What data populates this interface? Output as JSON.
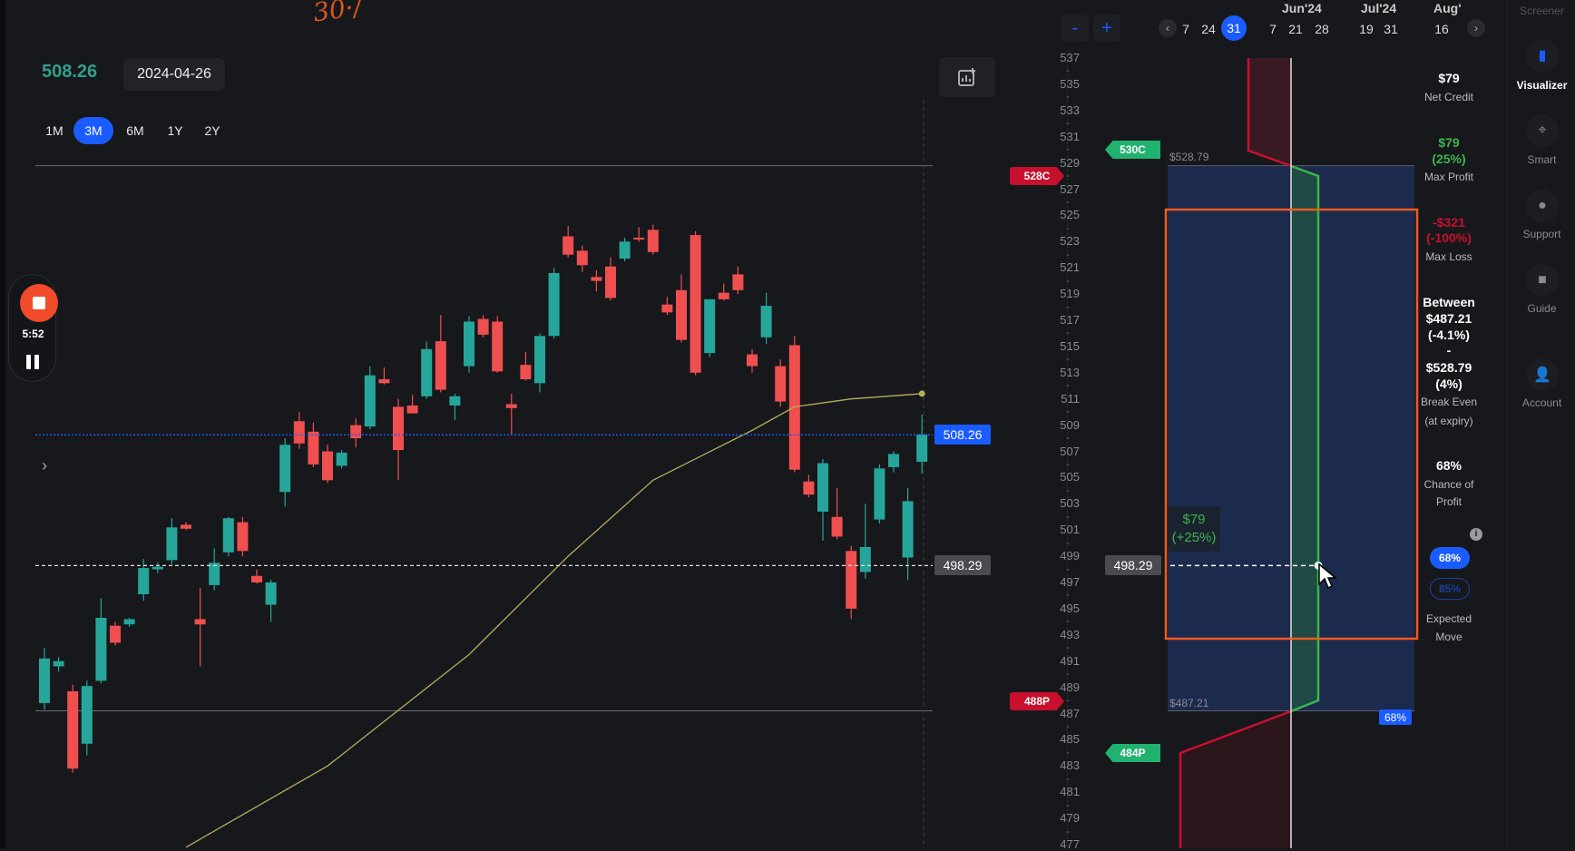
{
  "header": {
    "price": "508.26",
    "date": "2024-04-26",
    "annotation": "30·/"
  },
  "timeframes": [
    {
      "label": "1M"
    },
    {
      "label": "3M",
      "active": true
    },
    {
      "label": "6M"
    },
    {
      "label": "1Y"
    },
    {
      "label": "2Y"
    }
  ],
  "recorder": {
    "time": "5:52"
  },
  "price_tags": {
    "current": "508.26",
    "cursor": "498.29",
    "cursor_right": "498.29"
  },
  "strikes": {
    "short_call": "528C",
    "long_call": "530C",
    "short_put": "488P",
    "long_put": "484P"
  },
  "breakeven_labels": {
    "upper": "$528.79",
    "lower": "$487.21",
    "prob": "68%"
  },
  "tooltip": {
    "value": "$79",
    "pct": "(+25%)"
  },
  "zoom": {
    "minus": "-",
    "plus": "+"
  },
  "dates": {
    "months": [
      "Jun'24",
      "Jul'24",
      "Aug'"
    ],
    "days": [
      "7",
      "24",
      "31",
      "7",
      "21",
      "28",
      "19",
      "31",
      "16"
    ],
    "selected": "31"
  },
  "stats": {
    "net_credit": {
      "value": "$79",
      "label": "Net Credit"
    },
    "max_profit": {
      "value": "$79",
      "pct": "(25%)",
      "label": "Max Profit"
    },
    "max_loss": {
      "value": "-$321",
      "pct": "(-100%)",
      "label": "Max Loss"
    },
    "break_even": {
      "prefix": "Between",
      "low": "$487.21",
      "low_pct": "(-4.1%)",
      "sep": "-",
      "high": "$528.79",
      "high_pct": "(4%)",
      "label": "Break Even",
      "sub": "(at expiry)"
    },
    "chance": {
      "value": "68%",
      "label1": "Chance of",
      "label2": "Profit"
    },
    "expected_move": {
      "opt1": "68%",
      "opt2": "85%",
      "selected": "68%",
      "label1": "Expected",
      "label2": "Move"
    }
  },
  "sidebar": {
    "items": [
      {
        "label": "Screener"
      },
      {
        "label": "Visualizer",
        "active": true
      },
      {
        "label": "Smart"
      },
      {
        "label": "Support"
      },
      {
        "label": "Guide"
      },
      {
        "label": "Account"
      }
    ]
  },
  "colors": {
    "up": "#26a69a",
    "down": "#ef4f4f",
    "accent": "#1a5cff",
    "ma": "#b5ad5c",
    "profit_zone": "#1c2a4e",
    "expected_move_box": "#f05a1e"
  },
  "chart_data": {
    "type": "candlestick",
    "ylim": [
      477,
      537
    ],
    "axis_ticks": [
      537,
      535,
      533,
      531,
      529,
      527,
      525,
      523,
      521,
      519,
      517,
      515,
      513,
      511,
      509,
      507,
      505,
      503,
      501,
      499,
      497,
      495,
      493,
      491,
      489,
      487,
      485,
      483,
      481,
      479,
      477
    ],
    "reference_lines": {
      "current": 508.26,
      "cursor": 498.29,
      "upper_breakeven": 528.79,
      "lower_breakeven": 487.21
    },
    "ohlc": [
      [
        487.8,
        492,
        487.3,
        491.2
      ],
      [
        490.6,
        491.3,
        490.2,
        491
      ],
      [
        488.7,
        489.2,
        482.5,
        482.8
      ],
      [
        484.7,
        489.5,
        483.8,
        489.1
      ],
      [
        489.5,
        495.8,
        489.3,
        494.3
      ],
      [
        493.7,
        494,
        492.2,
        492.4
      ],
      [
        493.8,
        494.3,
        493.6,
        494.2
      ],
      [
        496.1,
        498.8,
        495.6,
        498.1
      ],
      [
        498,
        498.5,
        497.7,
        498.2
      ],
      [
        498.7,
        501.9,
        498.4,
        501.2
      ],
      [
        501.4,
        501.6,
        501,
        501.1
      ],
      [
        494.2,
        496.6,
        490.6,
        493.8
      ],
      [
        496.8,
        499.6,
        496.4,
        498.5
      ],
      [
        499.3,
        502,
        499,
        501.9
      ],
      [
        501.6,
        502,
        499,
        499.4
      ],
      [
        497.5,
        498,
        496.9,
        497
      ],
      [
        495.3,
        497.2,
        494,
        497
      ],
      [
        503.9,
        508,
        502.8,
        507.5
      ],
      [
        509.3,
        510,
        507.2,
        507.6
      ],
      [
        508.5,
        509.2,
        505.8,
        506
      ],
      [
        507,
        507.5,
        504.6,
        504.8
      ],
      [
        505.9,
        507.1,
        505.7,
        506.9
      ],
      [
        509,
        509.5,
        507.3,
        508
      ],
      [
        508.9,
        513.5,
        508.7,
        512.8
      ],
      [
        512.5,
        513.4,
        512.1,
        512.2
      ],
      [
        510.4,
        511,
        504.8,
        507.1
      ],
      [
        510.5,
        511.3,
        509.9,
        509.9
      ],
      [
        511.2,
        515.4,
        511,
        514.8
      ],
      [
        515.4,
        517.4,
        511.5,
        511.7
      ],
      [
        510.5,
        511.4,
        509.4,
        511.2
      ],
      [
        513.5,
        517.3,
        513,
        516.9
      ],
      [
        517.1,
        517.4,
        515.7,
        515.9
      ],
      [
        516.9,
        517.3,
        513,
        513.1
      ],
      [
        510.6,
        511.4,
        508.3,
        510.3
      ],
      [
        513.6,
        514.6,
        512.4,
        512.5
      ],
      [
        512.2,
        516,
        511.5,
        515.8
      ],
      [
        515.8,
        521,
        515.6,
        520.6
      ],
      [
        523.4,
        524.2,
        521.8,
        522
      ],
      [
        522.3,
        522.7,
        520.7,
        521.2
      ],
      [
        520.3,
        520.8,
        519.2,
        520
      ],
      [
        521.1,
        521.8,
        518.5,
        518.7
      ],
      [
        521.7,
        523.3,
        521.5,
        523
      ],
      [
        523.3,
        524.1,
        523,
        523.2
      ],
      [
        523.9,
        524.3,
        522,
        522.2
      ],
      [
        518.2,
        518.8,
        517.4,
        517.6
      ],
      [
        519.3,
        520.5,
        515.3,
        515.5
      ],
      [
        523.5,
        523.8,
        512.8,
        513
      ],
      [
        514.5,
        518.6,
        514.2,
        518.6
      ],
      [
        519.1,
        519.8,
        518.5,
        518.6
      ],
      [
        520.5,
        521.1,
        519,
        519.3
      ],
      [
        514.4,
        514.8,
        513,
        513.5
      ],
      [
        515.7,
        519.1,
        515.2,
        518.1
      ],
      [
        513.5,
        514,
        510.4,
        510.8
      ],
      [
        515.1,
        515.8,
        505.4,
        505.6
      ],
      [
        504.7,
        505.2,
        503.5,
        503.7
      ],
      [
        502.4,
        506.4,
        500.2,
        506.1
      ],
      [
        502,
        504.2,
        500.3,
        500.5
      ],
      [
        499.4,
        499.8,
        494.2,
        495
      ],
      [
        497.8,
        503,
        497.3,
        499.7
      ],
      [
        501.8,
        506,
        501.5,
        505.7
      ],
      [
        505.8,
        507,
        505.4,
        506.8
      ],
      [
        498.9,
        504.2,
        497.2,
        503.2
      ],
      [
        506.2,
        509.8,
        505.3,
        508.3
      ]
    ],
    "moving_average": [
      [
        10,
        476.8
      ],
      [
        20,
        483
      ],
      [
        30,
        491.5
      ],
      [
        37,
        499
      ],
      [
        43,
        504.8
      ],
      [
        50,
        508.6
      ],
      [
        53,
        510.4
      ],
      [
        57,
        511
      ],
      [
        62,
        511.4
      ]
    ]
  }
}
